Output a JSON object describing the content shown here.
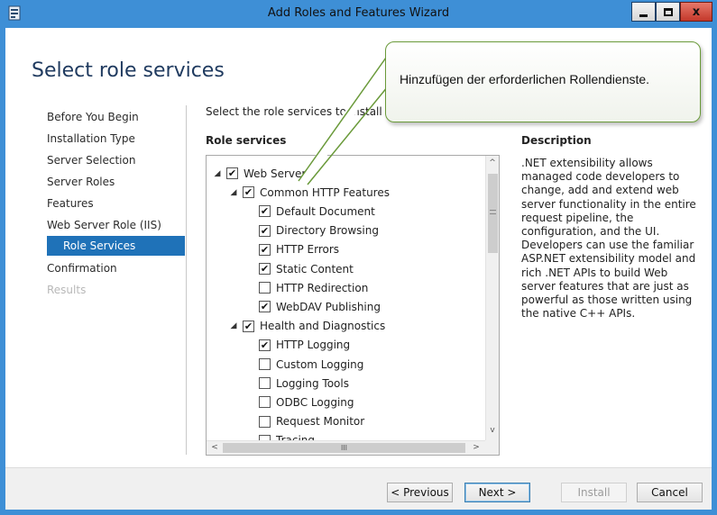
{
  "window": {
    "title": "Add Roles and Features Wizard",
    "minimize_icon": "minimize-icon",
    "maximize_icon": "maximize-icon",
    "close_label": "x"
  },
  "page": {
    "title": "Select role services"
  },
  "nav": {
    "items": [
      {
        "label": "Before You Begin",
        "state": "normal"
      },
      {
        "label": "Installation Type",
        "state": "normal"
      },
      {
        "label": "Server Selection",
        "state": "normal"
      },
      {
        "label": "Server Roles",
        "state": "normal"
      },
      {
        "label": "Features",
        "state": "normal"
      },
      {
        "label": "Web Server Role (IIS)",
        "state": "normal"
      },
      {
        "label": "Role Services",
        "state": "selected"
      },
      {
        "label": "Confirmation",
        "state": "normal"
      },
      {
        "label": "Results",
        "state": "disabled"
      }
    ]
  },
  "content": {
    "instruction": "Select the role services to install for W",
    "role_services_header": "Role services",
    "description_header": "Description",
    "description_text": ".NET extensibility allows managed code developers to change, add and extend web server functionality in the entire request pipeline, the configuration, and the UI. Developers can use the familiar ASP.NET extensibility model and rich .NET APIs to build Web server features that are just as powerful as those written using the native C++ APIs."
  },
  "tree": {
    "items": [
      {
        "label": "Web Server",
        "level": 0,
        "checked": true,
        "expanded": true
      },
      {
        "label": "Common HTTP Features",
        "level": 1,
        "checked": true,
        "expanded": true
      },
      {
        "label": "Default Document",
        "level": 2,
        "checked": true
      },
      {
        "label": "Directory Browsing",
        "level": 2,
        "checked": true
      },
      {
        "label": "HTTP Errors",
        "level": 2,
        "checked": true
      },
      {
        "label": "Static Content",
        "level": 2,
        "checked": true
      },
      {
        "label": "HTTP Redirection",
        "level": 2,
        "checked": false
      },
      {
        "label": "WebDAV Publishing",
        "level": 2,
        "checked": true
      },
      {
        "label": "Health and Diagnostics",
        "level": 1,
        "checked": true,
        "expanded": true
      },
      {
        "label": "HTTP Logging",
        "level": 2,
        "checked": true
      },
      {
        "label": "Custom Logging",
        "level": 2,
        "checked": false
      },
      {
        "label": "Logging Tools",
        "level": 2,
        "checked": false
      },
      {
        "label": "ODBC Logging",
        "level": 2,
        "checked": false
      },
      {
        "label": "Request Monitor",
        "level": 2,
        "checked": false
      },
      {
        "label": "Tracing",
        "level": 2,
        "checked": false
      }
    ],
    "hscroll_center_glyph": "III"
  },
  "footer": {
    "previous_label": "< Previous",
    "next_label": "Next >",
    "install_label": "Install",
    "cancel_label": "Cancel"
  },
  "callout": {
    "text": "Hinzufügen der erforderlichen Rollendienste."
  },
  "colors": {
    "frame": "#3e8fd6",
    "nav_selected": "#1f72b8",
    "callout_border": "#6a9a3a",
    "title_text": "#1f3a5f"
  }
}
